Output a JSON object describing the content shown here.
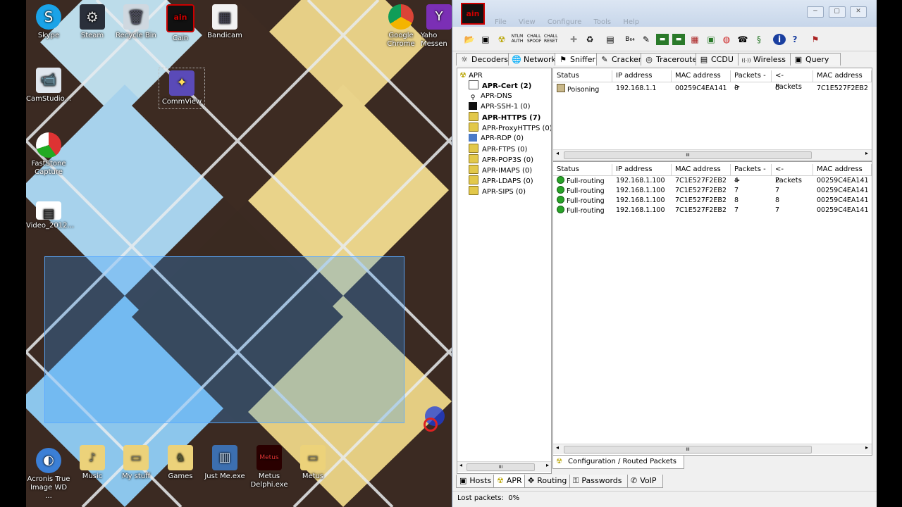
{
  "desktop": {
    "icons": [
      {
        "label": "Skype",
        "color": "#1aa3e8",
        "glyph": "S"
      },
      {
        "label": "Steam",
        "color": "#2a2f3a",
        "glyph": "⚙"
      },
      {
        "label": "Recycle Bin",
        "color": "#cfd8e0",
        "glyph": "🗑"
      },
      {
        "label": "Cain",
        "color": "#111111",
        "glyph": "ain"
      },
      {
        "label": "Bandicam",
        "color": "#f2f2f2",
        "glyph": "▦"
      },
      {
        "label": "Google Chrome",
        "color": "#2ca24c",
        "glyph": "◉"
      },
      {
        "label": "Yaho Messen",
        "color": "#7b2fb5",
        "glyph": "Y"
      },
      {
        "label": "CamStudio...",
        "color": "#dfe6ee",
        "glyph": "📹"
      },
      {
        "label": "CommView",
        "color": "#5a4ab8",
        "glyph": "✦"
      },
      {
        "label": "FastStone Capture",
        "color": "#ffffff",
        "glyph": "◔"
      },
      {
        "label": "Video_2012...",
        "color": "#ffffff",
        "glyph": "▤"
      },
      {
        "label": "Acronis True Image WD ...",
        "color": "#3b7fd6",
        "glyph": "◐"
      },
      {
        "label": "Music",
        "color": "#ecd27a",
        "glyph": "♪"
      },
      {
        "label": "My stuff",
        "color": "#ecd27a",
        "glyph": "▭"
      },
      {
        "label": "Games",
        "color": "#ecd27a",
        "glyph": "♞"
      },
      {
        "label": "Just Me.exe",
        "color": "#3c6fb0",
        "glyph": "▥"
      },
      {
        "label": "Metus Delphi.exe",
        "color": "#2a0000",
        "glyph": "Metus"
      },
      {
        "label": "Metus",
        "color": "#ecd27a",
        "glyph": "▭"
      }
    ]
  },
  "window": {
    "logo": "ain",
    "menu": [
      "File",
      "View",
      "Configure",
      "Tools",
      "Help"
    ],
    "controls": [
      "─",
      "▢",
      "✕"
    ],
    "toolbar_icons": [
      "open-icon",
      "network-card-icon",
      "apr-icon",
      "ntlm-icon",
      "chall-icon",
      "chall-reset-icon",
      "add-icon",
      "certificate-icon",
      "save-icon",
      "base64-icon",
      "decode-icon",
      "terminal-icon",
      "hash-icon",
      "hex-icon",
      "calc-icon",
      "route-icon",
      "voip-icon",
      "snake-icon",
      "info-icon",
      "help-icon",
      "flag-icon"
    ],
    "tabs_top": [
      {
        "label": "Decoders",
        "icon": "☼"
      },
      {
        "label": "Network",
        "icon": "🌐"
      },
      {
        "label": "Sniffer",
        "icon": "⚑"
      },
      {
        "label": "Cracker",
        "icon": "✎"
      },
      {
        "label": "Traceroute",
        "icon": "◎"
      },
      {
        "label": "CCDU",
        "icon": "▤"
      },
      {
        "label": "Wireless",
        "icon": "((·))"
      },
      {
        "label": "Query",
        "icon": "▣"
      }
    ],
    "tree": {
      "root": "APR",
      "items": [
        {
          "label": "APR-Cert (2)",
          "bold": true,
          "icon": "cert"
        },
        {
          "label": "APR-DNS",
          "bold": false,
          "icon": "dns"
        },
        {
          "label": "APR-SSH-1 (0)",
          "bold": false,
          "icon": "ssh"
        },
        {
          "label": "APR-HTTPS (7)",
          "bold": true,
          "icon": "lock"
        },
        {
          "label": "APR-ProxyHTTPS (0)",
          "bold": false,
          "icon": "lock"
        },
        {
          "label": "APR-RDP (0)",
          "bold": false,
          "icon": "rdp"
        },
        {
          "label": "APR-FTPS (0)",
          "bold": false,
          "icon": "lock"
        },
        {
          "label": "APR-POP3S (0)",
          "bold": false,
          "icon": "lock"
        },
        {
          "label": "APR-IMAPS (0)",
          "bold": false,
          "icon": "lock"
        },
        {
          "label": "APR-LDAPS (0)",
          "bold": false,
          "icon": "lock"
        },
        {
          "label": "APR-SIPS (0)",
          "bold": false,
          "icon": "lock"
        }
      ]
    },
    "columns": [
      "Status",
      "IP address",
      "MAC address",
      "Packets ->",
      "<- Packets",
      "MAC address"
    ],
    "top_rows": [
      [
        "Poisoning",
        "192.168.1.1",
        "00259C4EA141",
        "0",
        "0",
        "7C1E527F2EB2"
      ]
    ],
    "bottom_rows": [
      [
        "Full-routing",
        "192.168.1.100",
        "7C1E527F2EB2",
        "4",
        "2",
        "00259C4EA141"
      ],
      [
        "Full-routing",
        "192.168.1.100",
        "7C1E527F2EB2",
        "7",
        "7",
        "00259C4EA141"
      ],
      [
        "Full-routing",
        "192.168.1.100",
        "7C1E527F2EB2",
        "8",
        "8",
        "00259C4EA141"
      ],
      [
        "Full-routing",
        "192.168.1.100",
        "7C1E527F2EB2",
        "7",
        "7",
        "00259C4EA141"
      ]
    ],
    "scroll_grip": "III",
    "subtab": "Configuration / Routed Packets",
    "tabs_bottom": [
      {
        "label": "Hosts",
        "icon": "▣"
      },
      {
        "label": "APR",
        "icon": "☢"
      },
      {
        "label": "Routing",
        "icon": "✥"
      },
      {
        "label": "Passwords",
        "icon": "⚿"
      },
      {
        "label": "VoIP",
        "icon": "✆"
      }
    ],
    "status": "Lost packets:  0%"
  }
}
